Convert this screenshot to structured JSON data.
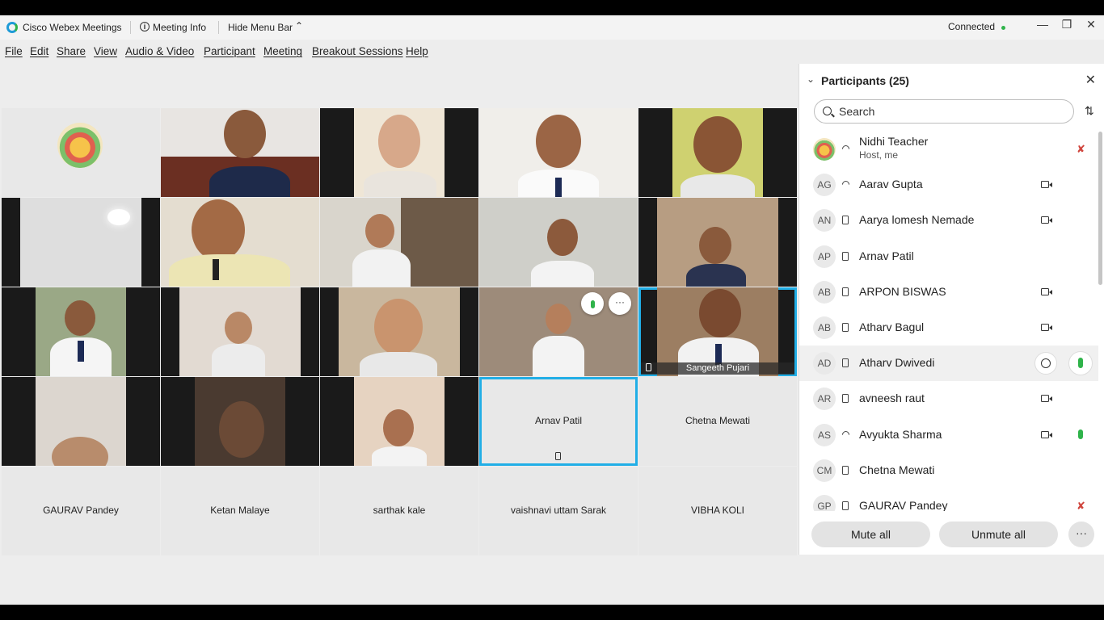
{
  "titlebar": {
    "app_name": "Cisco Webex Meetings",
    "meeting_info": "Meeting Info",
    "hide_menu_bar": "Hide Menu Bar",
    "status": "Connected",
    "status_color": "#2fb34a"
  },
  "menu": [
    "File",
    "Edit",
    "Share",
    "View",
    "Audio & Video",
    "Participant",
    "Meeting",
    "Breakout Sessions",
    "Help"
  ],
  "grid": {
    "highlighted_label": "Sangeeth Pujari",
    "name_tiles": [
      "Arnav Patil",
      "Chetna Mewati",
      "GAURAV Pandey",
      "Ketan Malaye",
      "sarthak kale",
      "vaishnavi uttam Sarak",
      "VIBHA KOLI"
    ]
  },
  "participants": {
    "title": "Participants (25)",
    "search_placeholder": "Search",
    "list": [
      {
        "initials": "",
        "name": "Nidhi Teacher",
        "sub": "Host, me",
        "device": "sound",
        "video": false,
        "mic": "muted"
      },
      {
        "initials": "AG",
        "name": "Aarav Gupta",
        "device": "sound",
        "video": true,
        "mic": "none"
      },
      {
        "initials": "AN",
        "name": "Aarya lomesh Nemade",
        "device": "phone",
        "video": true,
        "mic": "none"
      },
      {
        "initials": "AP",
        "name": "Arnav Patil",
        "device": "phone",
        "video": false,
        "mic": "none"
      },
      {
        "initials": "AB",
        "name": "ARPON BISWAS",
        "device": "phone",
        "video": true,
        "mic": "none"
      },
      {
        "initials": "AB",
        "name": "Atharv Bagul",
        "device": "phone",
        "video": true,
        "mic": "none"
      },
      {
        "initials": "AD",
        "name": "Atharv Dwivedi",
        "device": "phone",
        "video": false,
        "mic": "on-circle"
      },
      {
        "initials": "AR",
        "name": "avneesh raut",
        "device": "phone",
        "video": true,
        "mic": "none"
      },
      {
        "initials": "AS",
        "name": "Avyukta Sharma",
        "device": "sound",
        "video": true,
        "mic": "on"
      },
      {
        "initials": "CM",
        "name": "Chetna Mewati",
        "device": "phone",
        "video": false,
        "mic": "none"
      },
      {
        "initials": "GP",
        "name": "GAURAV Pandey",
        "device": "phone",
        "video": false,
        "mic": "muted"
      }
    ],
    "mute_all": "Mute all",
    "unmute_all": "Unmute all",
    "more": "···"
  }
}
